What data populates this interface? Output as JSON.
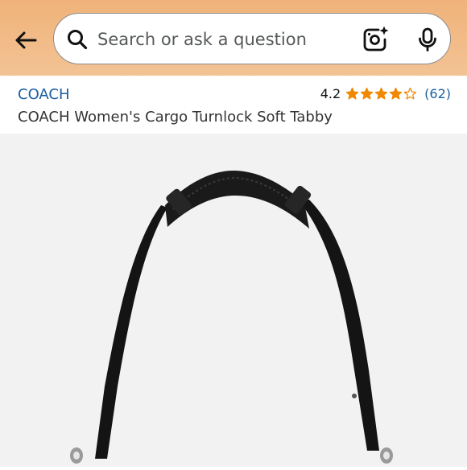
{
  "search": {
    "placeholder": "Search or ask a question"
  },
  "product": {
    "brand": "COACH",
    "title": "COACH Women's Cargo Turnlock Soft Tabby",
    "rating": "4.2",
    "rating_value": 4.2,
    "reviews": "(62)"
  },
  "icons": {
    "back": "back-arrow-icon",
    "search": "search-icon",
    "camera": "camera-lens-icon",
    "mic": "microphone-icon",
    "star": "star-icon"
  },
  "colors": {
    "header_bg": "#f0b27a",
    "link": "#1a5e9e",
    "star": "#f08804",
    "text": "#333333"
  }
}
